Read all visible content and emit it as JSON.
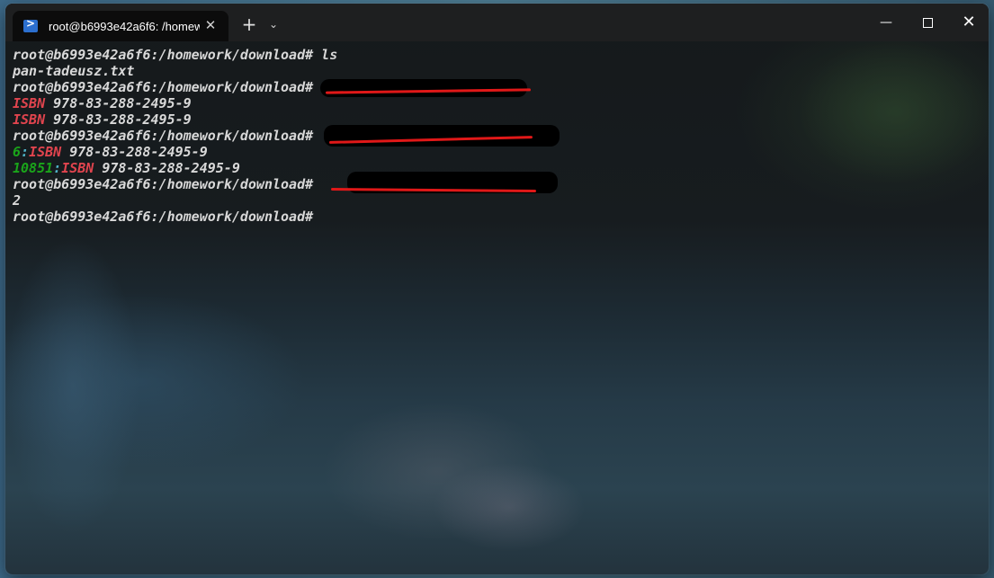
{
  "window": {
    "tab_title": "root@b6993e42a6f6: /homew",
    "tab_icon": "powershell-icon",
    "close_tab_glyph": "✕",
    "new_tab_glyph": "+",
    "dropdown_glyph": "⌄",
    "minimize_glyph": "—",
    "close_glyph": "✕"
  },
  "terminal": {
    "prompt": "root@b6993e42a6f6:/homework/download#",
    "lines": [
      {
        "prompt": "root@b6993e42a6f6:/homework/download#",
        "command": " ls"
      },
      {
        "text": "pan-tadeusz.txt"
      },
      {
        "prompt": "root@b6993e42a6f6:/homework/download#",
        "command": ""
      },
      {
        "match": "ISBN",
        "rest": " 978-83-288-2495-9"
      },
      {
        "match": "ISBN",
        "rest": " 978-83-288-2495-9"
      },
      {
        "prompt": "root@b6993e42a6f6:/homework/download#",
        "command": ""
      },
      {
        "lineno": "6",
        "sep": ":",
        "match": "ISBN",
        "rest": " 978-83-288-2495-9"
      },
      {
        "lineno": "10851",
        "sep": ":",
        "match": "ISBN",
        "rest": " 978-83-288-2495-9"
      },
      {
        "prompt": "root@b6993e42a6f6:/homework/download#",
        "command": ""
      },
      {
        "text": "2"
      },
      {
        "prompt": "root@b6993e42a6f6:/homework/download#",
        "command": ""
      }
    ]
  },
  "colors": {
    "match": "#e0444e",
    "line_number": "#1aa51a",
    "separator": "#4fb3c8",
    "text": "#d8d8d8",
    "redaction_mark": "#e01818"
  }
}
